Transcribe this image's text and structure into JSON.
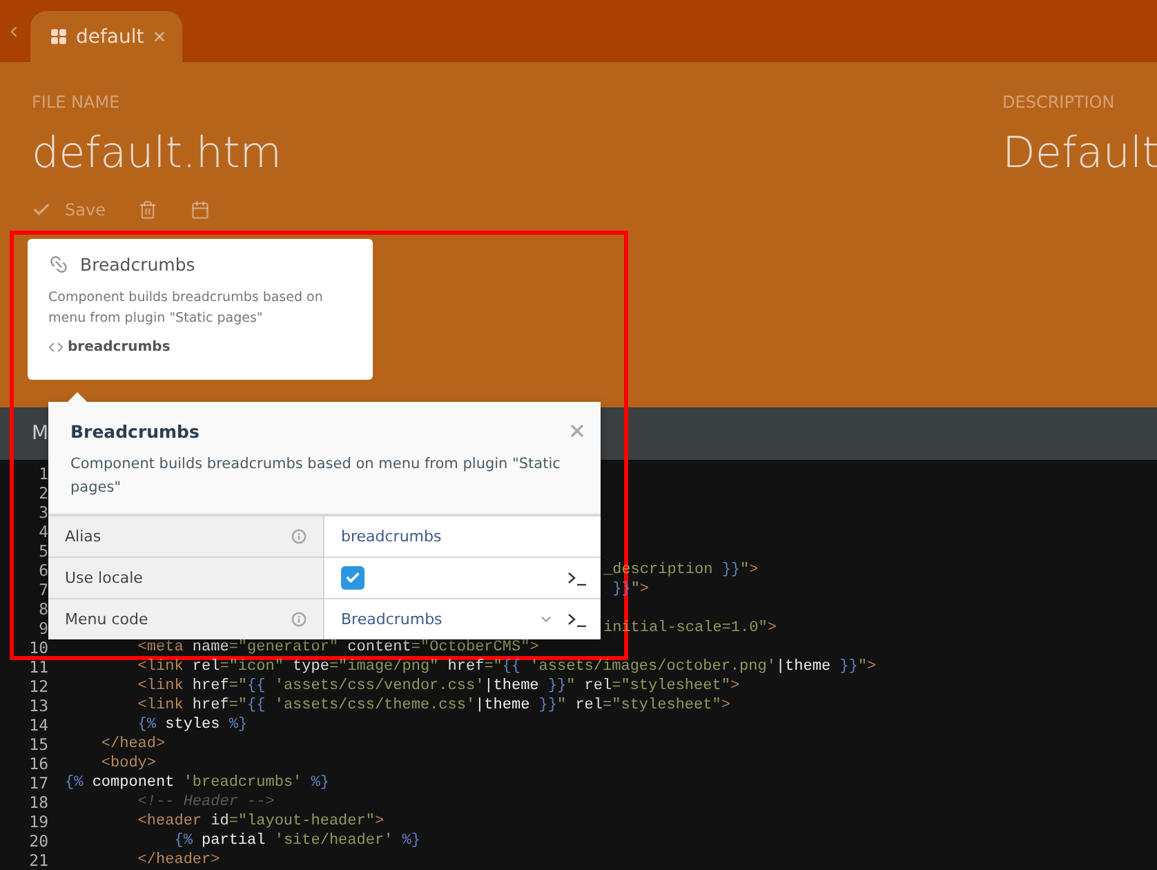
{
  "tab": {
    "label": "default",
    "selected": true
  },
  "header": {
    "file_name_label": "FILE NAME",
    "file_name": "default.htm",
    "description_label": "DESCRIPTION",
    "description": "Default",
    "toolbar": {
      "save": "Save"
    }
  },
  "component_card": {
    "title": "Breadcrumbs",
    "description": "Component builds breadcrumbs based on menu from plugin \"Static pages\"",
    "alias": "breadcrumbs"
  },
  "section_tab": {
    "label": "M"
  },
  "popup": {
    "title": "Breadcrumbs",
    "description": "Component builds breadcrumbs based on menu from plugin \"Static pages\"",
    "properties": [
      {
        "label": "Alias",
        "info": true,
        "kind": "text",
        "value": "breadcrumbs",
        "property_button": false
      },
      {
        "label": "Use locale",
        "info": false,
        "kind": "checkbox",
        "checked": true,
        "property_button": true
      },
      {
        "label": "Menu code",
        "info": true,
        "kind": "dropdown",
        "value": "Breadcrumbs",
        "property_button": true
      }
    ]
  },
  "code": [
    {
      "number": "1"
    },
    {
      "number": "2"
    },
    {
      "number": "3"
    },
    {
      "number": "4"
    },
    {
      "number": "5"
    },
    {
      "number": "6",
      "covered": true,
      "tokens": [
        {
          "kind": "str",
          "t": "_description "
        },
        {
          "kind": "twig",
          "t": "}}"
        },
        {
          "kind": "str",
          "t": "\""
        },
        {
          "kind": "tag",
          "t": ">"
        }
      ]
    },
    {
      "number": "7",
      "covered": true,
      "tokens": [
        {
          "kind": "twig",
          "t": " }}"
        },
        {
          "kind": "str",
          "t": "\""
        },
        {
          "kind": "tag",
          "t": ">"
        }
      ]
    },
    {
      "number": "8"
    },
    {
      "number": "9",
      "covered": true,
      "tokens": [
        {
          "kind": "str",
          "t": "initial-scale=1.0\""
        },
        {
          "kind": "tag",
          "t": ">"
        }
      ]
    },
    {
      "number": "10",
      "tokens": [
        {
          "kind": "tag",
          "t": "        <meta "
        },
        {
          "kind": "attr",
          "t": "name"
        },
        {
          "kind": "str",
          "t": "=\"generator\" "
        },
        {
          "kind": "attr",
          "t": "content"
        },
        {
          "kind": "str",
          "t": "=\"OctoberCMS\""
        },
        {
          "kind": "tag",
          "t": ">"
        }
      ]
    },
    {
      "number": "11",
      "tokens": [
        {
          "kind": "tag",
          "t": "        <link "
        },
        {
          "kind": "attr",
          "t": "rel"
        },
        {
          "kind": "str",
          "t": "=\"icon\" "
        },
        {
          "kind": "attr",
          "t": "type"
        },
        {
          "kind": "str",
          "t": "=\"image/png\" "
        },
        {
          "kind": "attr",
          "t": "href"
        },
        {
          "kind": "str",
          "t": "=\""
        },
        {
          "kind": "twig",
          "t": "{{ "
        },
        {
          "kind": "str",
          "t": "'assets/images/october.png'"
        },
        {
          "kind": "kw",
          "t": "|theme "
        },
        {
          "kind": "twig",
          "t": "}}"
        },
        {
          "kind": "str",
          "t": "\""
        },
        {
          "kind": "tag",
          "t": ">"
        }
      ]
    },
    {
      "number": "12",
      "tokens": [
        {
          "kind": "tag",
          "t": "        <link "
        },
        {
          "kind": "attr",
          "t": "href"
        },
        {
          "kind": "str",
          "t": "=\""
        },
        {
          "kind": "twig",
          "t": "{{ "
        },
        {
          "kind": "str",
          "t": "'assets/css/vendor.css'"
        },
        {
          "kind": "kw",
          "t": "|theme "
        },
        {
          "kind": "twig",
          "t": "}}"
        },
        {
          "kind": "str",
          "t": "\" "
        },
        {
          "kind": "attr",
          "t": "rel"
        },
        {
          "kind": "str",
          "t": "=\"stylesheet\""
        },
        {
          "kind": "tag",
          "t": ">"
        }
      ]
    },
    {
      "number": "13",
      "tokens": [
        {
          "kind": "tag",
          "t": "        <link "
        },
        {
          "kind": "attr",
          "t": "href"
        },
        {
          "kind": "str",
          "t": "=\""
        },
        {
          "kind": "twig",
          "t": "{{ "
        },
        {
          "kind": "str",
          "t": "'assets/css/theme.css'"
        },
        {
          "kind": "kw",
          "t": "|theme "
        },
        {
          "kind": "twig",
          "t": "}}"
        },
        {
          "kind": "str",
          "t": "\" "
        },
        {
          "kind": "attr",
          "t": "rel"
        },
        {
          "kind": "str",
          "t": "=\"stylesheet\""
        },
        {
          "kind": "tag",
          "t": ">"
        }
      ]
    },
    {
      "number": "14",
      "tokens": [
        {
          "kind": "twig",
          "t": "        {% "
        },
        {
          "kind": "kw",
          "t": "styles "
        },
        {
          "kind": "twig",
          "t": "%}"
        }
      ]
    },
    {
      "number": "15",
      "tokens": [
        {
          "kind": "tag",
          "t": "    </head>"
        }
      ]
    },
    {
      "number": "16",
      "tokens": [
        {
          "kind": "tag",
          "t": "    <body>"
        }
      ]
    },
    {
      "number": "17",
      "tokens": [
        {
          "kind": "twig",
          "t": "{% "
        },
        {
          "kind": "kw",
          "t": "component "
        },
        {
          "kind": "str",
          "t": "'breadcrumbs' "
        },
        {
          "kind": "twig",
          "t": "%}"
        }
      ]
    },
    {
      "number": "18",
      "tokens": [
        {
          "kind": "comment",
          "t": "        <!-- Header -->"
        }
      ]
    },
    {
      "number": "19",
      "tokens": [
        {
          "kind": "tag",
          "t": "        <header "
        },
        {
          "kind": "attr",
          "t": "id"
        },
        {
          "kind": "str",
          "t": "=\"layout-header\""
        },
        {
          "kind": "tag",
          "t": ">"
        }
      ]
    },
    {
      "number": "20",
      "tokens": [
        {
          "kind": "twig",
          "t": "            {% "
        },
        {
          "kind": "kw",
          "t": "partial "
        },
        {
          "kind": "str",
          "t": "'site/header' "
        },
        {
          "kind": "twig",
          "t": "%}"
        }
      ]
    },
    {
      "number": "21",
      "tokens": [
        {
          "kind": "tag",
          "t": "        </header>"
        }
      ]
    }
  ]
}
